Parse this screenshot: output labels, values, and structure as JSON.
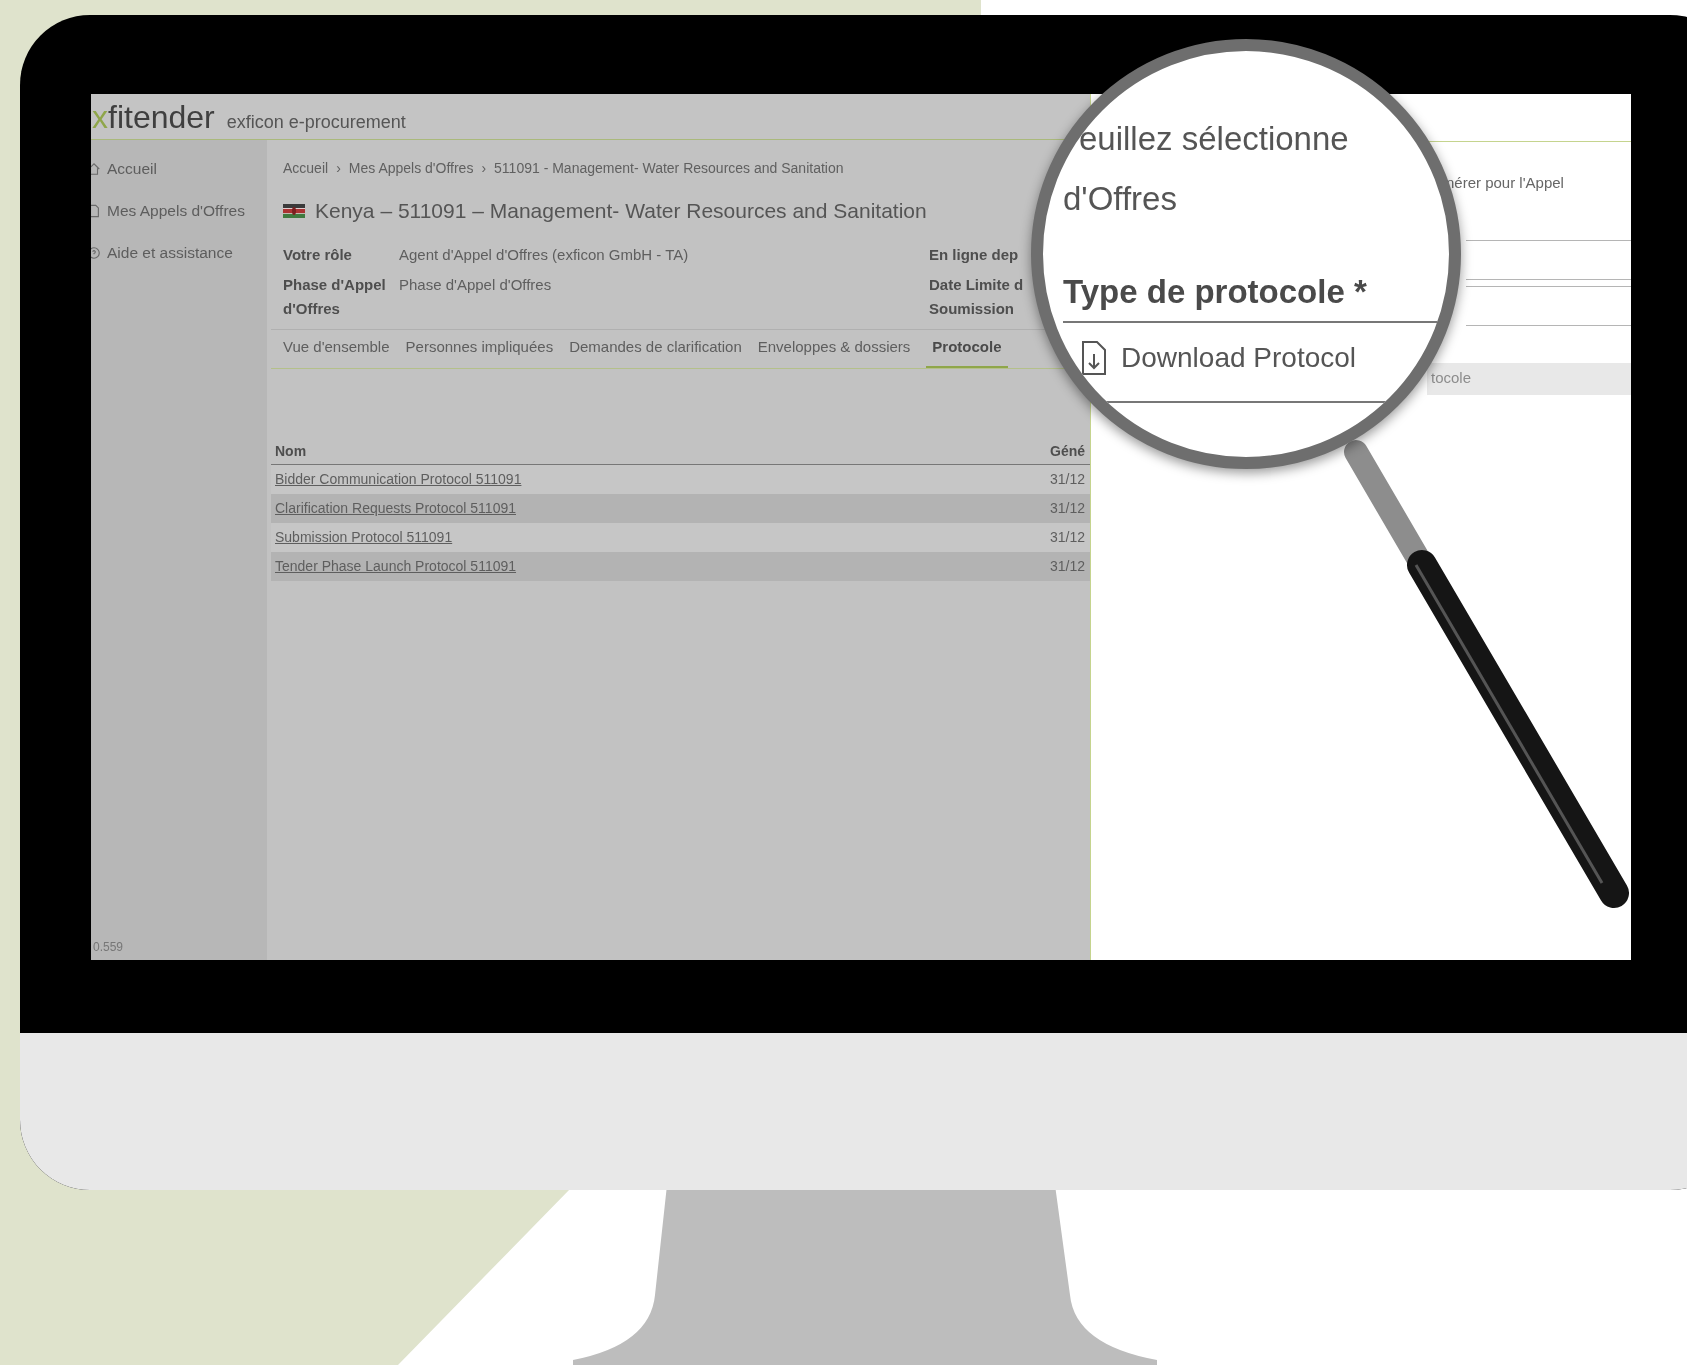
{
  "app": {
    "logo_accent": "x",
    "logo_rest": "fitender",
    "product": "exficon e-procurement"
  },
  "sidebar": {
    "items": [
      {
        "kind": "home",
        "label": "Accueil"
      },
      {
        "kind": "document",
        "label": "Mes Appels d'Offres"
      },
      {
        "kind": "help",
        "label": "Aide et assistance"
      }
    ],
    "version": "0.559"
  },
  "breadcrumb": {
    "separator": "›",
    "items": [
      "Accueil",
      "Mes Appels d'Offres",
      "511091 - Management- Water Resources and Sanitation"
    ]
  },
  "title": "Kenya – 511091 – Management- Water Resources and Sanitation",
  "info": [
    {
      "label": "Votre rôle",
      "value": "Agent d'Appel d'Offres (exficon GmbH - TA)",
      "right_label": "En ligne dep"
    },
    {
      "label": "Phase d'Appel d'Offres",
      "value": "Phase d'Appel d'Offres",
      "right_label": "Date Limite d Soumission"
    }
  ],
  "tabs": [
    {
      "label": "Vue d'ensemble",
      "selected": false
    },
    {
      "label": "Personnes impliquées",
      "selected": false
    },
    {
      "label": "Demandes de clarification",
      "selected": false
    },
    {
      "label": "Enveloppes & dossiers",
      "selected": false
    },
    {
      "label": "Protocole",
      "selected": true
    }
  ],
  "table": {
    "columns": [
      "Nom",
      "Géné"
    ],
    "rows": [
      {
        "name": "Bidder Communication Protocol 511091",
        "date": "31/12"
      },
      {
        "name": "Clarification Requests Protocol 511091",
        "date": "31/12"
      },
      {
        "name": "Submission Protocol 511091",
        "date": "31/12"
      },
      {
        "name": "Tender Phase Launch Protocol 511091",
        "date": "31/12"
      }
    ]
  },
  "side_panel": {
    "text": "nérer pour l'Appel",
    "button": "tocole"
  },
  "magnifier": {
    "intro_lines": [
      "euillez sélectionne",
      "d'Offres"
    ],
    "field_label": "Type de protocole *",
    "download": "Download Protocol"
  }
}
